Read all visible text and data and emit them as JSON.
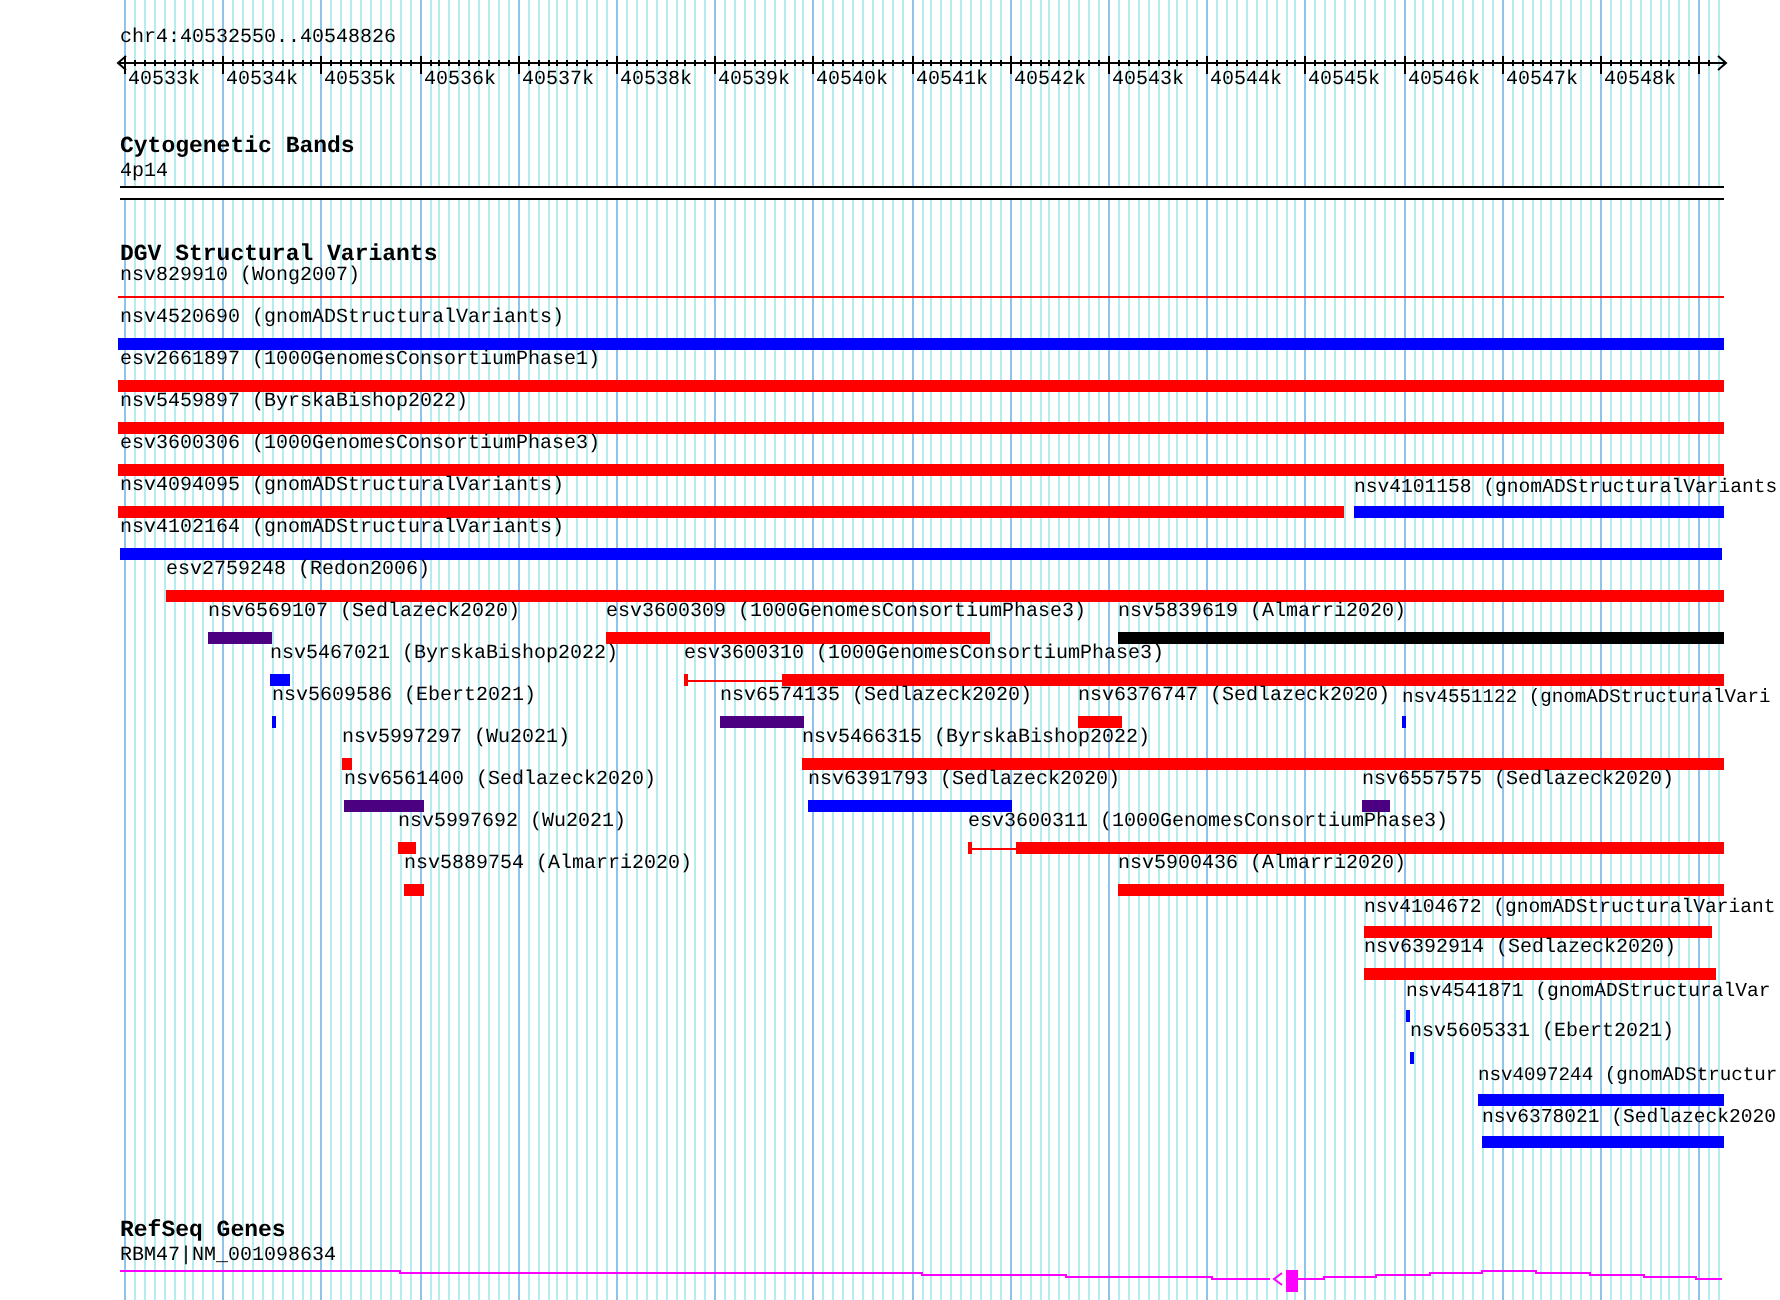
{
  "ruler": {
    "location": "chr4:40532550..40548826",
    "ticks": [
      "40533k",
      "40534k",
      "40535k",
      "40536k",
      "40537k",
      "40538k",
      "40539k",
      "40540k",
      "40541k",
      "40542k",
      "40543k",
      "40544k",
      "40545k",
      "40546k",
      "40547k",
      "40548k"
    ]
  },
  "tracks": [
    {
      "title": "Cytogenetic Bands",
      "kind": "bands",
      "features": [
        {
          "label": "4p14"
        }
      ]
    },
    {
      "title": "DGV Structural Variants",
      "kind": "variants",
      "features": [
        {
          "label": "nsv829910 (Wong2007)",
          "color": "#ff0000",
          "kind": "line"
        },
        {
          "label": "nsv4520690 (gnomADStructuralVariants)",
          "color": "#0000ff",
          "kind": "bar"
        },
        {
          "label": "esv2661897 (1000GenomesConsortiumPhase1)",
          "color": "#ff0000",
          "kind": "bar"
        },
        {
          "label": "nsv5459897 (ByrskaBishop2022)",
          "color": "#ff0000",
          "kind": "bar"
        },
        {
          "label": "esv3600306 (1000GenomesConsortiumPhase3)",
          "color": "#ff0000",
          "kind": "bar"
        },
        {
          "label": "nsv4094095 (gnomADStructuralVariants)",
          "color": "#ff0000",
          "kind": "bar"
        },
        {
          "label": "nsv4101158 (gnomADStructuralVariants",
          "color": "#0000ff",
          "kind": "bar"
        },
        {
          "label": "nsv4102164 (gnomADStructuralVariants)",
          "color": "#0000ff",
          "kind": "bar"
        },
        {
          "label": "esv2759248 (Redon2006)",
          "color": "#ff0000",
          "kind": "bar"
        },
        {
          "label": "nsv6569107 (Sedlazeck2020)",
          "color": "#4b0082",
          "kind": "bar"
        },
        {
          "label": "esv3600309 (1000GenomesConsortiumPhase3)",
          "color": "#ff0000",
          "kind": "bar"
        },
        {
          "label": "nsv5839619 (Almarri2020)",
          "color": "#000000",
          "kind": "bar"
        },
        {
          "label": "nsv5467021 (ByrskaBishop2022)",
          "color": "#0000ff",
          "kind": "bar"
        },
        {
          "label": "esv3600310 (1000GenomesConsortiumPhase3)",
          "color": "#ff0000",
          "kind": "tailed"
        },
        {
          "label": "nsv5609586 (Ebert2021)",
          "color": "#0000ff",
          "kind": "bar"
        },
        {
          "label": "nsv6574135 (Sedlazeck2020)",
          "color": "#4b0082",
          "kind": "bar"
        },
        {
          "label": "nsv6376747 (Sedlazeck2020)",
          "color": "#ff0000",
          "kind": "bar"
        },
        {
          "label": "nsv4551122 (gnomADStructuralVari",
          "color": "#0000ff",
          "kind": "bar"
        },
        {
          "label": "nsv5997297 (Wu2021)",
          "color": "#ff0000",
          "kind": "bar"
        },
        {
          "label": "nsv5466315 (ByrskaBishop2022)",
          "color": "#ff0000",
          "kind": "bar"
        },
        {
          "label": "nsv6561400 (Sedlazeck2020)",
          "color": "#4b0082",
          "kind": "bar"
        },
        {
          "label": "nsv6391793 (Sedlazeck2020)",
          "color": "#0000ff",
          "kind": "bar"
        },
        {
          "label": "nsv6557575 (Sedlazeck2020)",
          "color": "#4b0082",
          "kind": "bar"
        },
        {
          "label": "nsv5997692 (Wu2021)",
          "color": "#ff0000",
          "kind": "bar"
        },
        {
          "label": "esv3600311 (1000GenomesConsortiumPhase3)",
          "color": "#ff0000",
          "kind": "tailed"
        },
        {
          "label": "nsv5889754 (Almarri2020)",
          "color": "#ff0000",
          "kind": "bar"
        },
        {
          "label": "nsv5900436 (Almarri2020)",
          "color": "#ff0000",
          "kind": "bar"
        },
        {
          "label": "nsv4104672 (gnomADStructuralVariant",
          "color": "#ff0000",
          "kind": "bar"
        },
        {
          "label": "nsv6392914 (Sedlazeck2020)",
          "color": "#ff0000",
          "kind": "bar"
        },
        {
          "label": "nsv4541871 (gnomADStructuralVar",
          "color": "#0000ff",
          "kind": "bar"
        },
        {
          "label": "nsv5605331 (Ebert2021)",
          "color": "#0000ff",
          "kind": "bar"
        },
        {
          "label": "nsv4097244 (gnomADStructur",
          "color": "#0000ff",
          "kind": "bar"
        },
        {
          "label": "nsv6378021 (Sedlazeck2020",
          "color": "#0000ff",
          "kind": "bar"
        }
      ]
    },
    {
      "title": "RefSeq Genes",
      "kind": "genes",
      "features": [
        {
          "label": "RBM47|NM_001098634"
        }
      ]
    }
  ]
}
